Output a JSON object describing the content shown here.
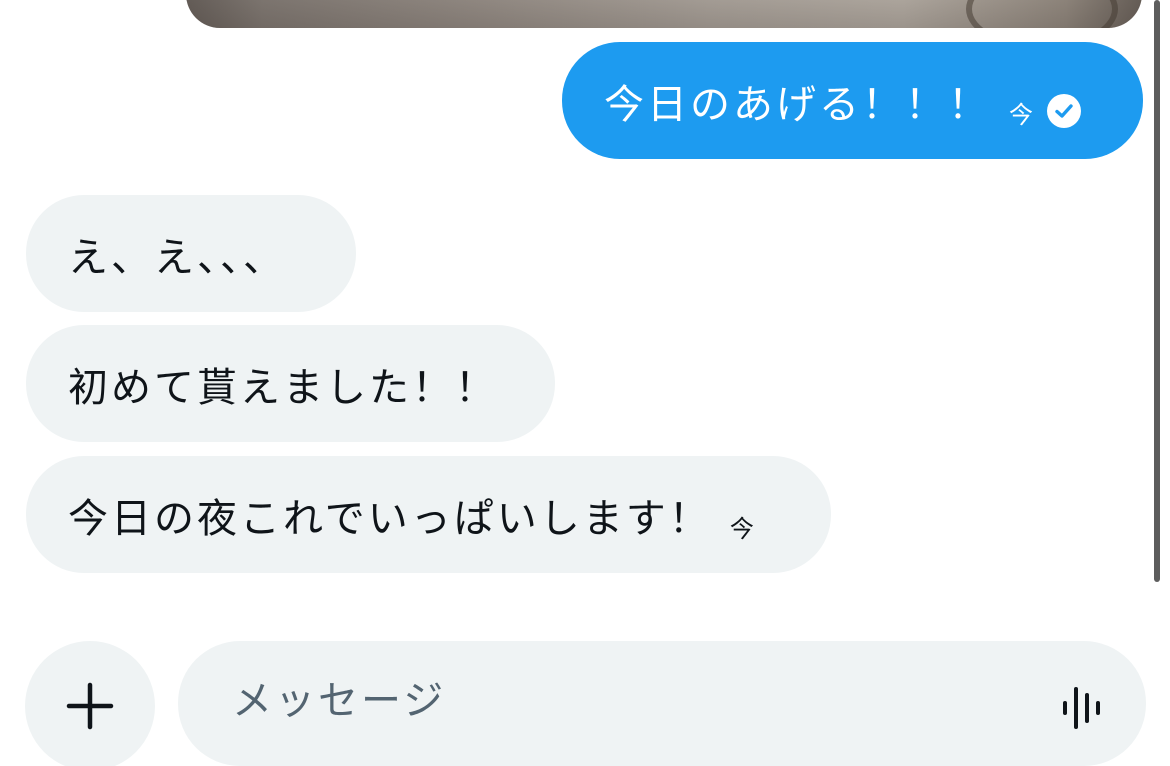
{
  "messages": {
    "outgoing": [
      {
        "text": "今日のあげる！！！",
        "time": "今",
        "status": "read-check-icon"
      }
    ],
    "incoming": [
      {
        "text": "え、え、、、"
      },
      {
        "text": "初めて貰えました！！"
      },
      {
        "text": "今日の夜これでいっぱいします！",
        "time": "今"
      }
    ]
  },
  "composer": {
    "placeholder": "メッセージ",
    "value": "",
    "add_icon": "plus-icon",
    "voice_icon": "voice-waveform-icon"
  },
  "colors": {
    "outgoing_bubble": "#1d9bf0",
    "incoming_bubble": "#eff3f4",
    "text_primary": "#0f1419",
    "placeholder": "#536471"
  }
}
